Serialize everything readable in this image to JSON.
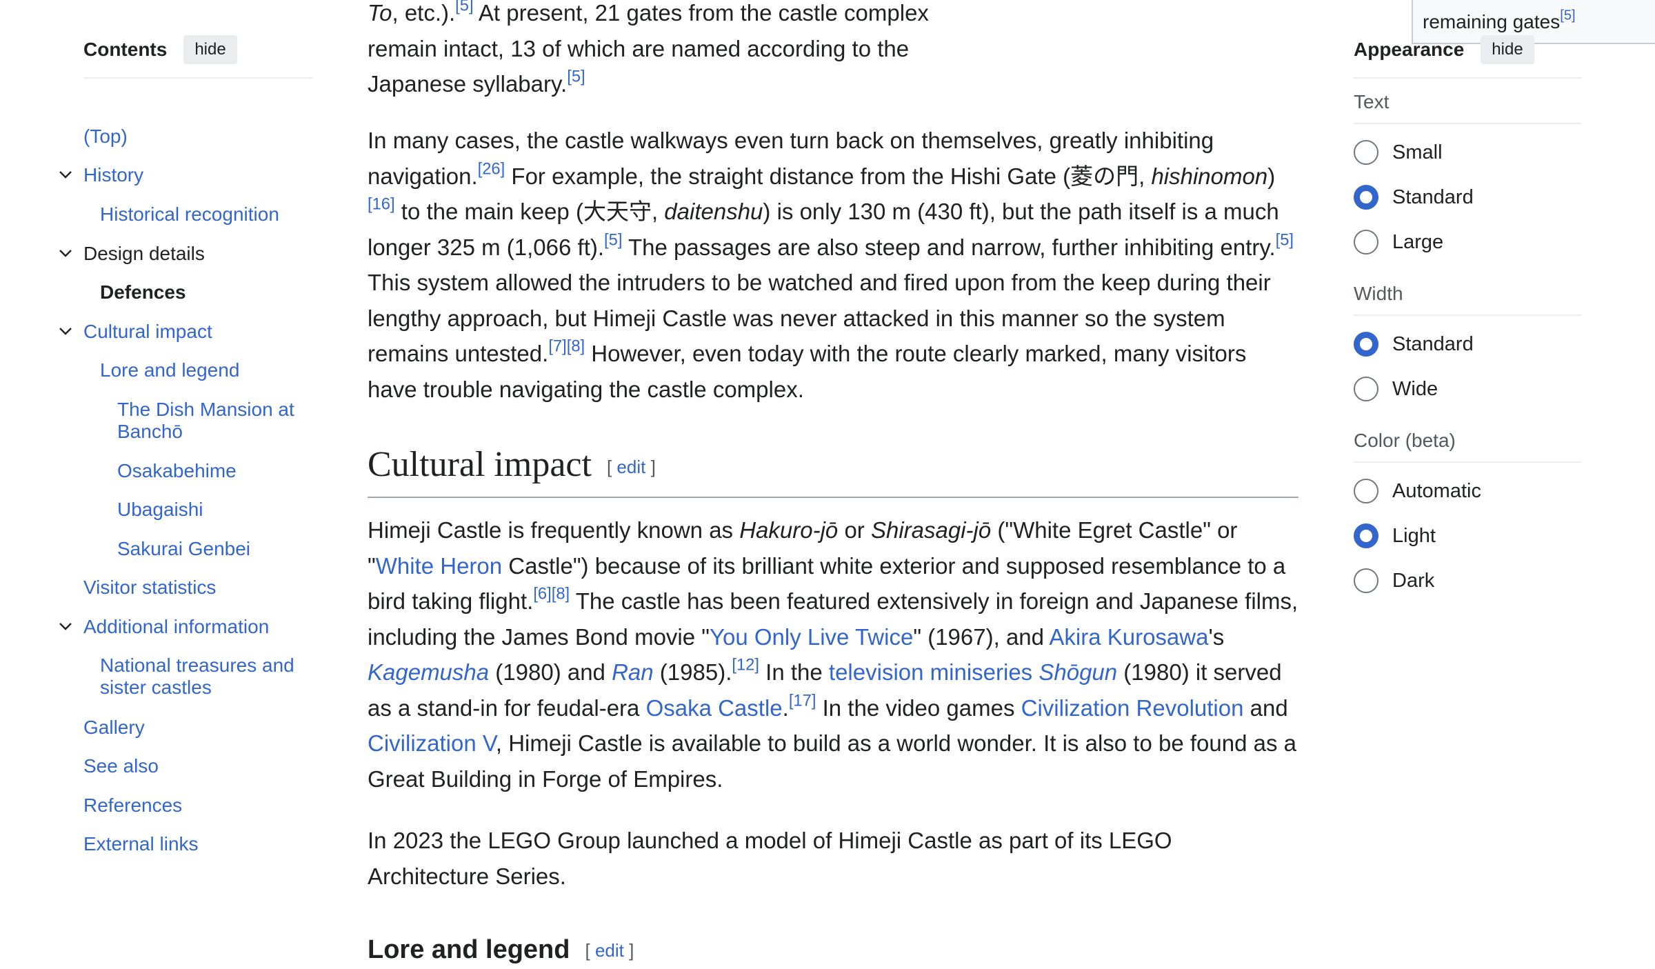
{
  "toc": {
    "title": "Contents",
    "hide_label": "hide",
    "items": [
      {
        "label": "(Top)"
      },
      {
        "label": "History"
      },
      {
        "label": "Historical recognition"
      },
      {
        "label": "Design details"
      },
      {
        "label": "Defences"
      },
      {
        "label": "Cultural impact"
      },
      {
        "label": "Lore and legend"
      },
      {
        "label": "The Dish Mansion at Banchō"
      },
      {
        "label": "Osakabehime"
      },
      {
        "label": "Ubagaishi"
      },
      {
        "label": "Sakurai Genbei"
      },
      {
        "label": "Visitor statistics"
      },
      {
        "label": "Additional information"
      },
      {
        "label": "National treasures and sister castles"
      },
      {
        "label": "Gallery"
      },
      {
        "label": "See also"
      },
      {
        "label": "References"
      },
      {
        "label": "External links"
      }
    ]
  },
  "infobox_tail": {
    "text": "remaining gates",
    "ref": "[5]"
  },
  "article": {
    "p1": {
      "t1": "To",
      "t2": ", etc.).",
      "r1": "[5]",
      "t3": " At present, 21 gates from the castle complex remain intact, 13 of which are named according to the Japanese syllabary.",
      "r2": "[5]"
    },
    "p2": {
      "t1": "In many cases, the castle walkways even turn back on themselves, greatly inhibiting navigation.",
      "r1": "[26]",
      "t2": " For example, the straight distance from the Hishi Gate (菱の門, ",
      "i1": "hishinomon",
      "t3": ")",
      "r2": "[16]",
      "t4": " to the main keep (大天守, ",
      "i2": "daitenshu",
      "t5": ") is only 130 m (430 ft), but the path itself is a much longer 325 m (1,066 ft).",
      "r3": "[5]",
      "t6": " The passages are also steep and narrow, further inhibiting entry.",
      "r4": "[5]",
      "t7": " This system allowed the intruders to be watched and fired upon from the keep during their lengthy approach, but Himeji Castle was never attacked in this manner so the system remains untested.",
      "r5": "[7]",
      "r6": "[8]",
      "t8": " However, even today with the route clearly marked, many visitors have trouble navigating the castle complex."
    },
    "h_cultural": "Cultural impact",
    "edit_label": "edit",
    "edit_open": "[",
    "edit_close": "]",
    "p3": {
      "t1": "Himeji Castle is frequently known as ",
      "i1": "Hakuro-jō",
      "t2": " or ",
      "i2": "Shirasagi-jō",
      "t3": " (\"White Egret Castle\" or \"",
      "l1": "White Heron",
      "t4": " Castle\") because of its brilliant white exterior and supposed resemblance to a bird taking flight.",
      "r1": "[6]",
      "r2": "[8]",
      "t5": " The castle has been featured extensively in foreign and Japanese films, including the James Bond movie \"",
      "l2": "You Only Live Twice",
      "t6": "\" (1967), and ",
      "l3": "Akira Kurosawa",
      "t7": "'s ",
      "l4": "Kagemusha",
      "t8": " (1980) and ",
      "l5": "Ran",
      "t9": " (1985).",
      "r3": "[12]",
      "t10": " In the ",
      "l6": "television miniseries ",
      "l6b": "Shōgun",
      "t11": " (1980) it served as a stand-in for feudal-era ",
      "l7": "Osaka Castle",
      "t12": ".",
      "r4": "[17]",
      "t13": " In the video games ",
      "l8": "Civilization Revolution",
      "t14": " and ",
      "l9": "Civilization V",
      "t15": ", Himeji Castle is available to build as a world wonder. It is also to be found as a Great Building in Forge of Empires."
    },
    "p4": "In 2023 the LEGO Group launched a model of Himeji Castle as part of its LEGO Architecture Series.",
    "h_lore": "Lore and legend"
  },
  "appearance": {
    "title": "Appearance",
    "hide_label": "hide",
    "text_label": "Text",
    "text_options": [
      "Small",
      "Standard",
      "Large"
    ],
    "width_label": "Width",
    "width_options": [
      "Standard",
      "Wide"
    ],
    "color_label": "Color (beta)",
    "color_options": [
      "Automatic",
      "Light",
      "Dark"
    ],
    "selected": {
      "text": "Standard",
      "width": "Standard",
      "color": "Light"
    }
  },
  "colors": {
    "link": "#3366cc",
    "text": "#202122",
    "radio_selected": "#3366cc"
  }
}
